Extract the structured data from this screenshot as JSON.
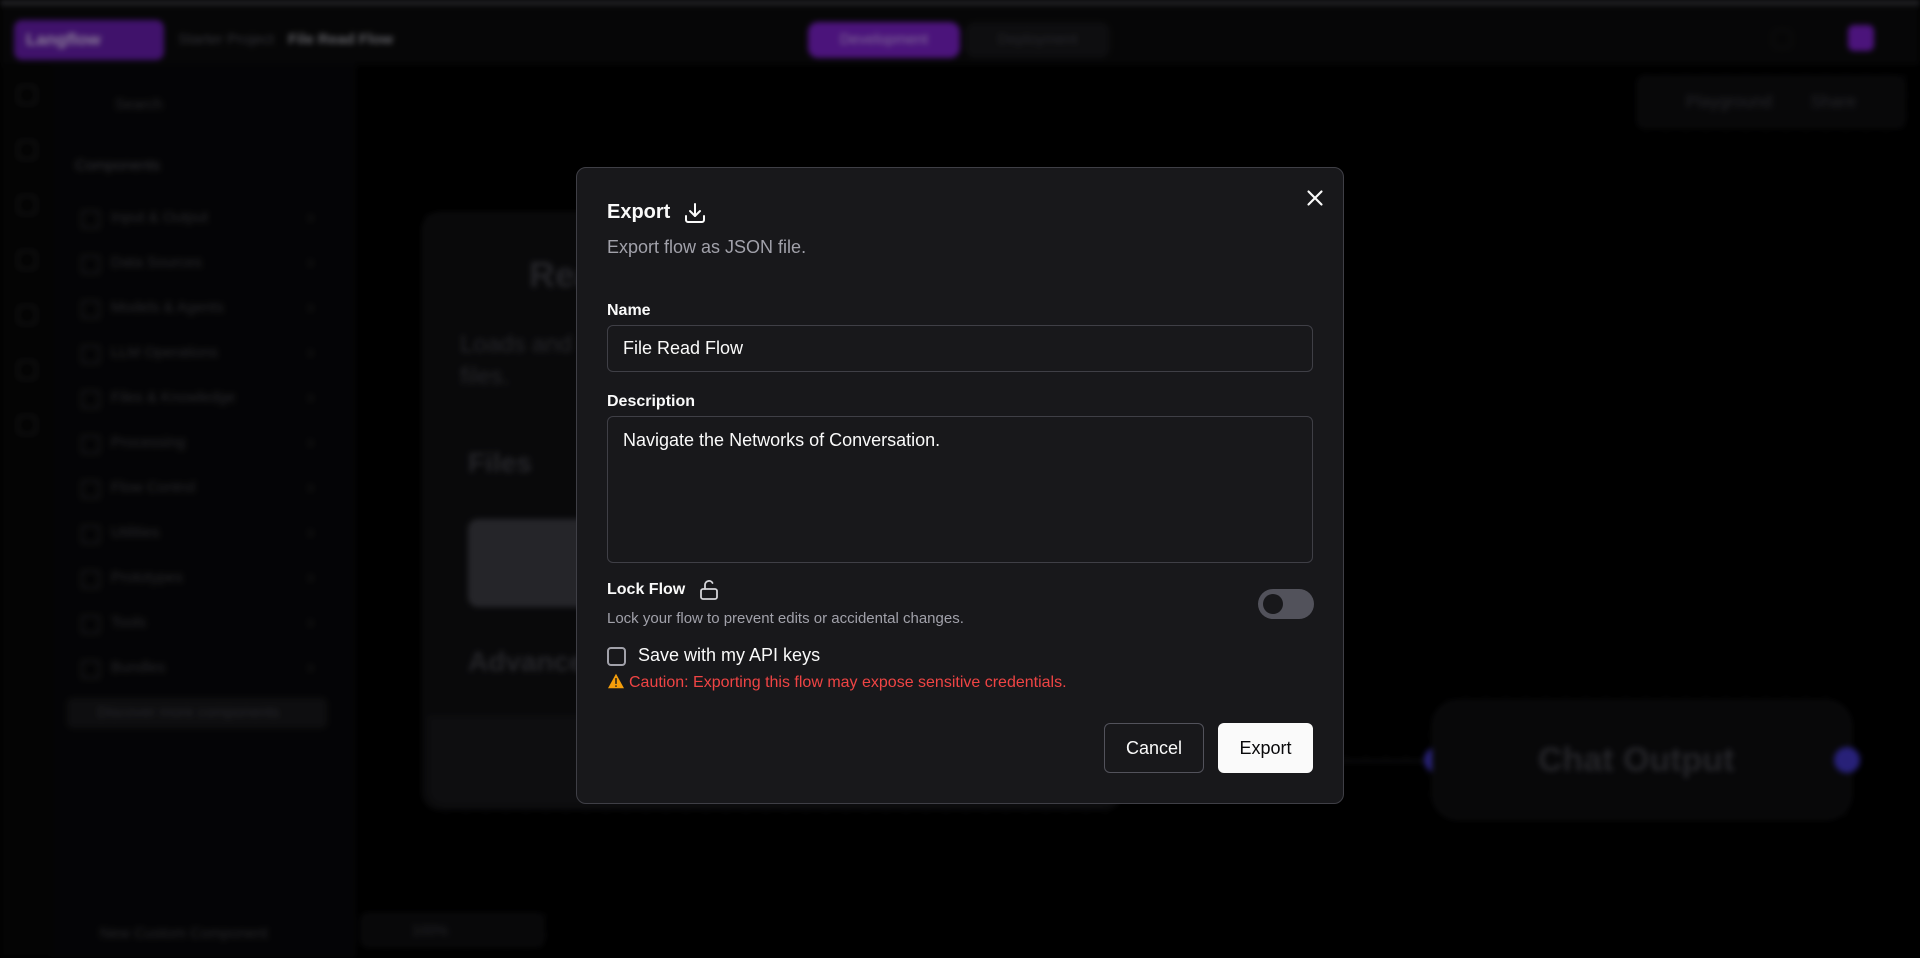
{
  "background": {
    "logo_text": "Langflow",
    "breadcrumb": {
      "folder": "Starter Project",
      "current": "File Read Flow"
    },
    "modes": {
      "development": "Development",
      "deployment": "Deployment"
    },
    "sidebar": {
      "search_placeholder": "Search",
      "section_title": "Components",
      "items": [
        {
          "label": "Input & Output"
        },
        {
          "label": "Data Sources"
        },
        {
          "label": "Models & Agents"
        },
        {
          "label": "LLM Operations"
        },
        {
          "label": "Files & Knowledge"
        },
        {
          "label": "Processing"
        },
        {
          "label": "Flow Control"
        },
        {
          "label": "Utilities"
        },
        {
          "label": "Prototypes"
        },
        {
          "label": "Tools"
        },
        {
          "label": "Bundles"
        }
      ],
      "discover_label": "Discover more components",
      "footer_label": "New Custom Component"
    },
    "playground_label": "Playground",
    "share_label": "Share",
    "node_file": {
      "title": "Read File",
      "description": "Loads and returns files.",
      "files_label": "Files",
      "advanced_label": "Advanced"
    },
    "node_chat_output": {
      "title": "Chat Output"
    },
    "zoom_label": "100%"
  },
  "modal": {
    "title": "Export",
    "subtitle": "Export flow as JSON file.",
    "name_label": "Name",
    "name_value": "File Read Flow",
    "description_label": "Description",
    "description_value": "Navigate the Networks of Conversation.",
    "lock_label": "Lock Flow",
    "lock_description": "Lock your flow to prevent edits or accidental changes.",
    "lock_enabled": false,
    "api_keys_label": "Save with my API keys",
    "api_keys_checked": false,
    "caution": "Caution: Exporting this flow may expose sensitive credentials.",
    "cancel_label": "Cancel",
    "export_label": "Export"
  },
  "colors": {
    "modal_bg": "#18181b",
    "accent": "#7e22ce",
    "caution": "#ef4444",
    "primary_button": "#fafafa"
  }
}
